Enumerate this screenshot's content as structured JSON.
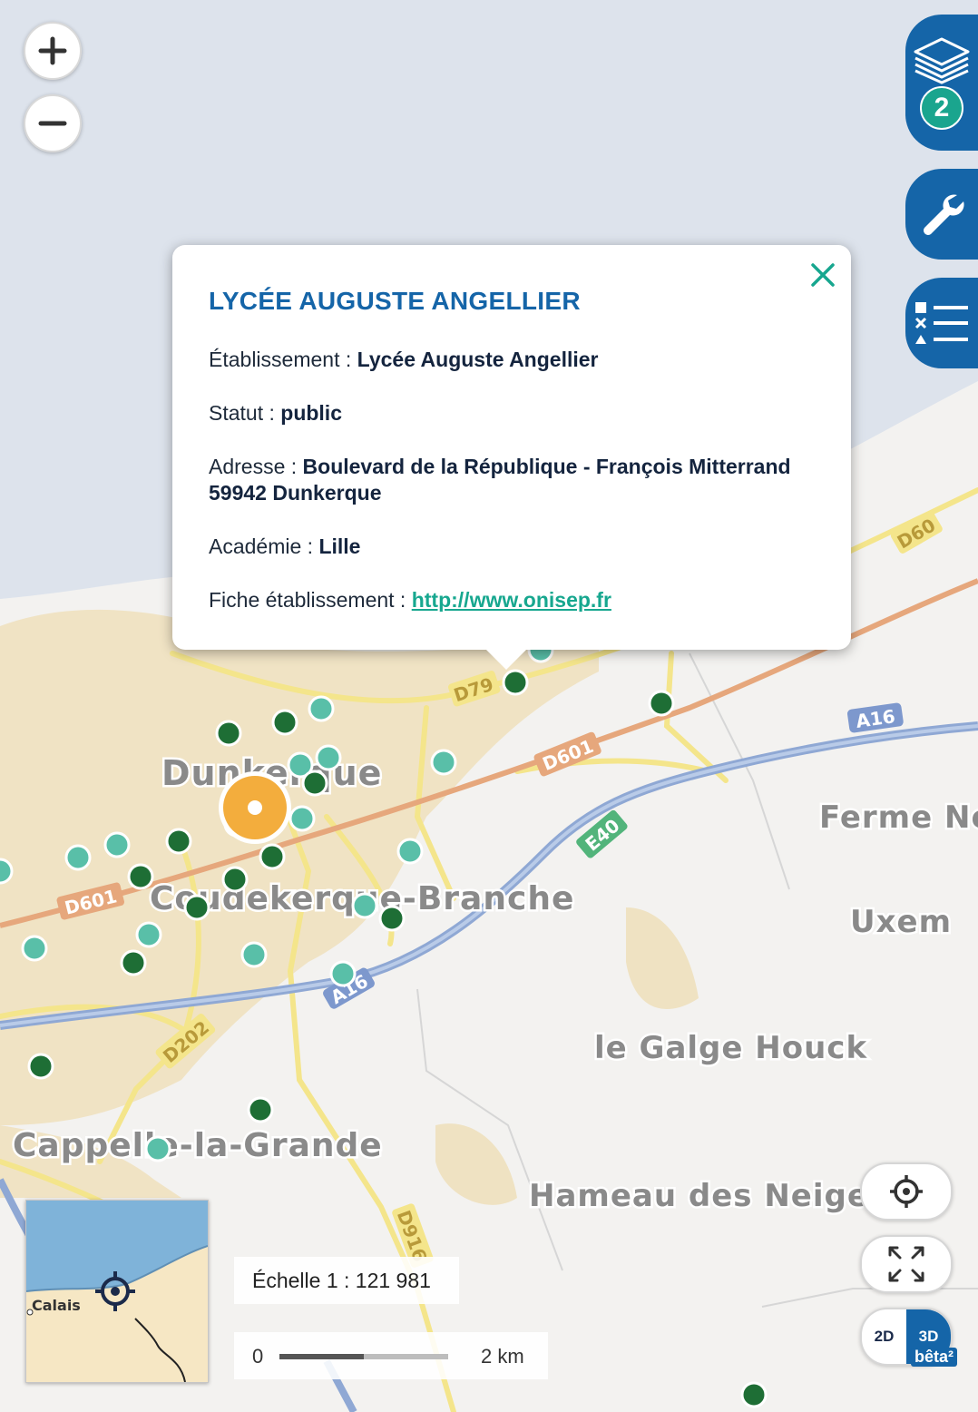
{
  "map": {
    "places": [
      {
        "key": "dunkerque",
        "text": "Dunkerque"
      },
      {
        "key": "coudekerque",
        "text": "Coudekerque-Branche"
      },
      {
        "key": "ferme",
        "text": "Ferme No"
      },
      {
        "key": "uxem",
        "text": "Uxem"
      },
      {
        "key": "galge",
        "text": "le Galge Houck"
      },
      {
        "key": "cappelle",
        "text": "Cappelle-la-Grande"
      },
      {
        "key": "hameau",
        "text": "Hameau des Neiges"
      }
    ],
    "roads": [
      "D60",
      "D79",
      "A16",
      "D601",
      "E40",
      "D601",
      "A16",
      "D202",
      "D916"
    ],
    "colors": {
      "sea": "#dde3ec",
      "urban": "#f0e3c4",
      "motorway": "#6f8fc9",
      "main_road": "#e6a77c",
      "secondary_road": "#f4e58b",
      "marker_dark": "#1e6e35",
      "marker_light": "#59bfa8",
      "selected_marker": "#f3ad3d"
    }
  },
  "controls": {
    "zoom_in_icon": "plus-icon",
    "zoom_out_icon": "minus-icon",
    "layers_badge": "2",
    "tools_icon": "wrench-icon",
    "legend_icon": "legend-list-icon",
    "locate_icon": "crosshair-icon",
    "fullscreen_icon": "expand-arrows-icon",
    "view_2d": "2D",
    "view_3d": "3D",
    "view_3d_beta": "bêta²"
  },
  "popup": {
    "title": "LYCÉE AUGUSTE ANGELLIER",
    "fields": [
      {
        "label": "Établissement : ",
        "value": "Lycée Auguste Angellier"
      },
      {
        "label": "Statut : ",
        "value": "public"
      },
      {
        "label": "Adresse : ",
        "value": "Boulevard de la République - François Mitterrand 59942 Dunkerque"
      },
      {
        "label": "Académie : ",
        "value": "Lille"
      }
    ],
    "link": {
      "label": "Fiche établissement : ",
      "text": "http://www.onisep.fr"
    }
  },
  "minimap": {
    "label": "Calais"
  },
  "scale": {
    "text": "Échelle 1 :  121 981",
    "bar_start": "0",
    "bar_end": "2 km"
  }
}
